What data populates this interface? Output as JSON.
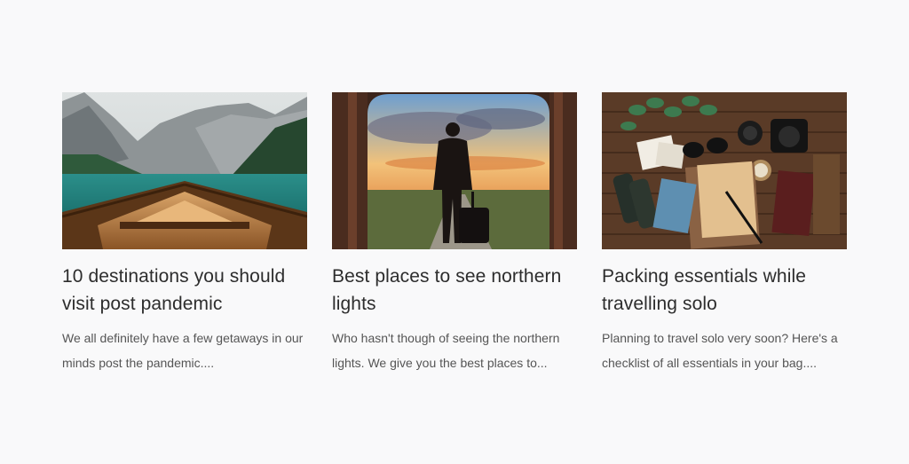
{
  "posts": [
    {
      "title": "10 destinations you should visit post pandemic",
      "excerpt": "We all definitely have a few getaways in our minds post the pandemic....",
      "image": "mountain-lake-boat-image"
    },
    {
      "title": "Best places to see northern lights",
      "excerpt": "Who hasn't though of seeing the northern lights. We give you the best places to...",
      "image": "traveler-sunset-image"
    },
    {
      "title": "Packing essentials while travelling solo",
      "excerpt": "Planning to travel solo very soon? Here's a checklist of all essentials in your bag....",
      "image": "travel-flatlay-image"
    }
  ]
}
